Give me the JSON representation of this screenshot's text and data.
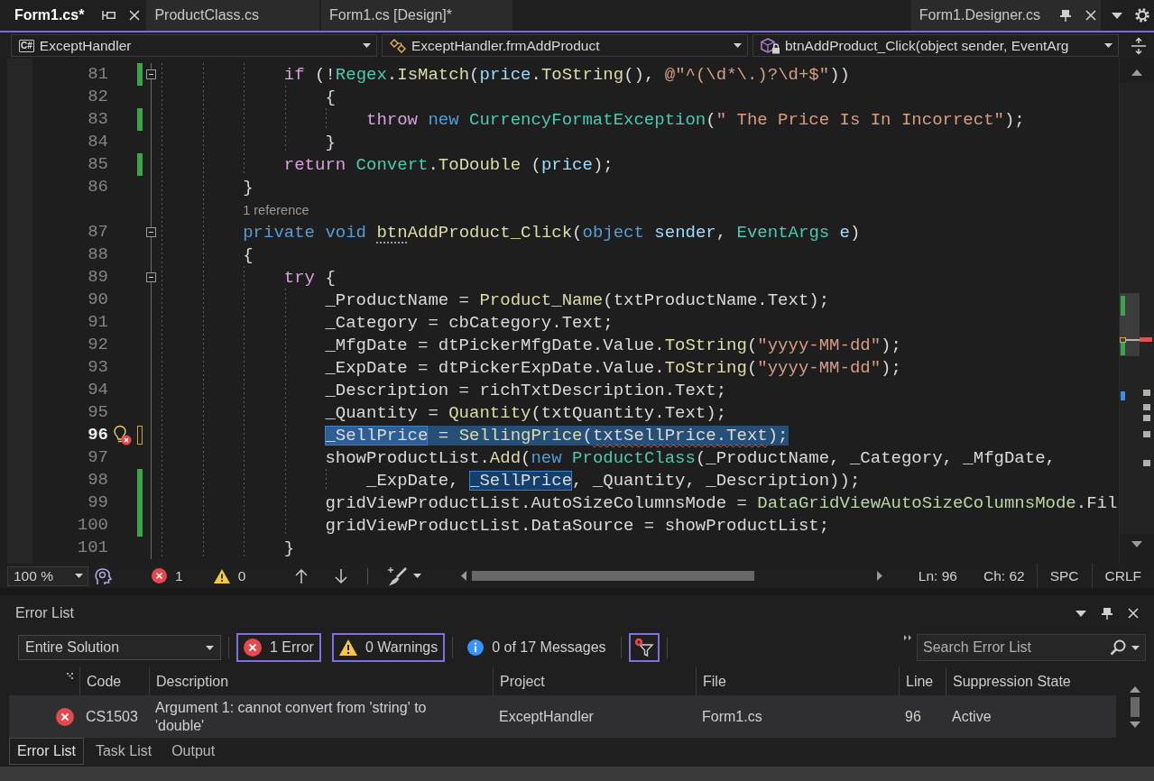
{
  "tabs": [
    {
      "label": "Form1.cs*",
      "selected": true,
      "pinned": false,
      "show_buttons": true
    },
    {
      "label": "ProductClass.cs",
      "selected": false,
      "pinned": false,
      "show_buttons": false
    },
    {
      "label": "Form1.cs [Design]*",
      "selected": false,
      "pinned": false,
      "show_buttons": false
    },
    {
      "label": "Form1.Designer.cs",
      "selected": false,
      "pinned": true,
      "show_buttons": true
    }
  ],
  "nav_bar": {
    "project_badge": "C#",
    "project": "ExceptHandler",
    "type": "ExceptHandler.frmAddProduct",
    "member": "btnAddProduct_Click(object sender, EventArg"
  },
  "editor": {
    "lines": [
      {
        "kind": "code",
        "number": "81",
        "current": false,
        "fold": true,
        "saved_change": true,
        "unsaved_change": false,
        "lightbulb": false,
        "selected": false,
        "code": [
          {
            "text": "            if",
            "kind": "control"
          },
          {
            "text": " (!",
            "kind": "plain"
          },
          {
            "text": "Regex",
            "kind": "type"
          },
          {
            "text": ".",
            "kind": "plain"
          },
          {
            "text": "IsMatch",
            "kind": "method"
          },
          {
            "text": "(",
            "kind": "plain"
          },
          {
            "text": "price",
            "kind": "param"
          },
          {
            "text": ".",
            "kind": "plain"
          },
          {
            "text": "ToString",
            "kind": "method"
          },
          {
            "text": "(), ",
            "kind": "plain"
          },
          {
            "text": "@\"^(\\d*\\.)?\\d+$\"",
            "kind": "string"
          },
          {
            "text": "))",
            "kind": "plain"
          }
        ]
      },
      {
        "kind": "code",
        "number": "82",
        "current": false,
        "fold": false,
        "saved_change": false,
        "unsaved_change": false,
        "lightbulb": false,
        "selected": false,
        "code": [
          {
            "text": "                {",
            "kind": "plain"
          }
        ]
      },
      {
        "kind": "code",
        "number": "83",
        "current": false,
        "fold": false,
        "saved_change": true,
        "unsaved_change": false,
        "lightbulb": false,
        "selected": false,
        "code": [
          {
            "text": "                    throw",
            "kind": "control"
          },
          {
            "text": " new",
            "kind": "keyword"
          },
          {
            "text": " CurrencyFormatException",
            "kind": "type"
          },
          {
            "text": "(",
            "kind": "plain"
          },
          {
            "text": "\" The Price Is In Incorrect\"",
            "kind": "string"
          },
          {
            "text": ");",
            "kind": "plain"
          }
        ]
      },
      {
        "kind": "code",
        "number": "84",
        "current": false,
        "fold": false,
        "saved_change": false,
        "unsaved_change": false,
        "lightbulb": false,
        "selected": false,
        "code": [
          {
            "text": "                }",
            "kind": "plain"
          }
        ]
      },
      {
        "kind": "code",
        "number": "85",
        "current": false,
        "fold": false,
        "saved_change": true,
        "unsaved_change": false,
        "lightbulb": false,
        "selected": false,
        "code": [
          {
            "text": "            return",
            "kind": "control"
          },
          {
            "text": " Convert",
            "kind": "type"
          },
          {
            "text": ".",
            "kind": "plain"
          },
          {
            "text": "ToDouble",
            "kind": "method"
          },
          {
            "text": " (",
            "kind": "plain"
          },
          {
            "text": "price",
            "kind": "param"
          },
          {
            "text": ");",
            "kind": "plain"
          }
        ]
      },
      {
        "kind": "code",
        "number": "86",
        "current": false,
        "fold": false,
        "saved_change": false,
        "unsaved_change": false,
        "lightbulb": false,
        "selected": false,
        "code": [
          {
            "text": "        }",
            "kind": "plain"
          }
        ]
      },
      {
        "kind": "codelens",
        "text": "1 reference"
      },
      {
        "kind": "code",
        "number": "87",
        "current": false,
        "fold": true,
        "saved_change": false,
        "unsaved_change": false,
        "lightbulb": false,
        "selected": false,
        "code": [
          {
            "text": "        private",
            "kind": "keyword"
          },
          {
            "text": " void ",
            "kind": "keyword"
          },
          {
            "text": "btn",
            "kind": "method",
            "hint": true
          },
          {
            "text": "AddProduct_Click",
            "kind": "method"
          },
          {
            "text": "(",
            "kind": "plain"
          },
          {
            "text": "object",
            "kind": "keyword"
          },
          {
            "text": " sender",
            "kind": "param"
          },
          {
            "text": ", ",
            "kind": "plain"
          },
          {
            "text": "EventArgs",
            "kind": "type"
          },
          {
            "text": " e",
            "kind": "param"
          },
          {
            "text": ")",
            "kind": "plain"
          }
        ]
      },
      {
        "kind": "code",
        "number": "88",
        "current": false,
        "fold": false,
        "saved_change": false,
        "unsaved_change": false,
        "lightbulb": false,
        "selected": false,
        "code": [
          {
            "text": "        {",
            "kind": "plain"
          }
        ]
      },
      {
        "kind": "code",
        "number": "89",
        "current": false,
        "fold": true,
        "saved_change": false,
        "unsaved_change": false,
        "lightbulb": false,
        "selected": false,
        "code": [
          {
            "text": "            try",
            "kind": "control"
          },
          {
            "text": " {",
            "kind": "plain"
          }
        ]
      },
      {
        "kind": "code",
        "number": "90",
        "current": false,
        "fold": false,
        "saved_change": false,
        "unsaved_change": false,
        "lightbulb": false,
        "selected": false,
        "code": [
          {
            "text": "                _ProductName = ",
            "kind": "plain"
          },
          {
            "text": "Product_Name",
            "kind": "method"
          },
          {
            "text": "(txtProductName.Text);",
            "kind": "plain"
          }
        ]
      },
      {
        "kind": "code",
        "number": "91",
        "current": false,
        "fold": false,
        "saved_change": false,
        "unsaved_change": false,
        "lightbulb": false,
        "selected": false,
        "code": [
          {
            "text": "                _Category = cbCategory.Text;",
            "kind": "plain"
          }
        ]
      },
      {
        "kind": "code",
        "number": "92",
        "current": false,
        "fold": false,
        "saved_change": false,
        "unsaved_change": false,
        "lightbulb": false,
        "selected": false,
        "code": [
          {
            "text": "                _MfgDate = dtPickerMfgDate.Value.",
            "kind": "plain"
          },
          {
            "text": "ToString",
            "kind": "method"
          },
          {
            "text": "(",
            "kind": "plain"
          },
          {
            "text": "\"yyyy-MM-dd\"",
            "kind": "string"
          },
          {
            "text": ");",
            "kind": "plain"
          }
        ]
      },
      {
        "kind": "code",
        "number": "93",
        "current": false,
        "fold": false,
        "saved_change": false,
        "unsaved_change": false,
        "lightbulb": false,
        "selected": false,
        "code": [
          {
            "text": "                _ExpDate = dtPickerExpDate.Value.",
            "kind": "plain"
          },
          {
            "text": "ToString",
            "kind": "method"
          },
          {
            "text": "(",
            "kind": "plain"
          },
          {
            "text": "\"yyyy-MM-dd\"",
            "kind": "string"
          },
          {
            "text": ");",
            "kind": "plain"
          }
        ]
      },
      {
        "kind": "code",
        "number": "94",
        "current": false,
        "fold": false,
        "saved_change": false,
        "unsaved_change": false,
        "lightbulb": false,
        "selected": false,
        "code": [
          {
            "text": "                _Description = richTxtDescription.Text;",
            "kind": "plain"
          }
        ]
      },
      {
        "kind": "code",
        "number": "95",
        "current": false,
        "fold": false,
        "saved_change": false,
        "unsaved_change": false,
        "lightbulb": false,
        "selected": false,
        "code": [
          {
            "text": "                _Quantity = ",
            "kind": "plain"
          },
          {
            "text": "Quantity",
            "kind": "method"
          },
          {
            "text": "(txtQuantity.Text);",
            "kind": "plain"
          }
        ]
      },
      {
        "kind": "code",
        "number": "96",
        "current": true,
        "fold": false,
        "saved_change": false,
        "unsaved_change": true,
        "lightbulb": true,
        "selected": true,
        "code": [
          {
            "text": "                _SellPrice",
            "kind": "plain",
            "highlighted": true
          },
          {
            "text": " = ",
            "kind": "plain"
          },
          {
            "text": "SellingPrice",
            "kind": "method"
          },
          {
            "text": "(",
            "kind": "plain"
          },
          {
            "text": "txtSellPrice.Text",
            "kind": "plain",
            "error": true
          },
          {
            "text": ");",
            "kind": "plain"
          }
        ]
      },
      {
        "kind": "code",
        "number": "97",
        "current": false,
        "fold": false,
        "saved_change": false,
        "unsaved_change": false,
        "lightbulb": false,
        "selected": false,
        "code": [
          {
            "text": "                showProductList.",
            "kind": "plain"
          },
          {
            "text": "Add",
            "kind": "method"
          },
          {
            "text": "(",
            "kind": "plain"
          },
          {
            "text": "new",
            "kind": "keyword"
          },
          {
            "text": " ProductClass",
            "kind": "type"
          },
          {
            "text": "(_ProductName, _Category, _MfgDate,",
            "kind": "plain"
          }
        ]
      },
      {
        "kind": "code",
        "number": "98",
        "current": false,
        "fold": false,
        "saved_change": true,
        "unsaved_change": false,
        "lightbulb": false,
        "selected": false,
        "code": [
          {
            "text": "                    _ExpDate, ",
            "kind": "plain"
          },
          {
            "text": "_SellPrice",
            "kind": "plain",
            "highlighted": true
          },
          {
            "text": ", _Quantity, _Description));",
            "kind": "plain"
          }
        ]
      },
      {
        "kind": "code",
        "number": "99",
        "current": false,
        "fold": false,
        "saved_change": true,
        "unsaved_change": false,
        "lightbulb": false,
        "selected": false,
        "code": [
          {
            "text": "                gridViewProductList.AutoSizeColumnsMode = ",
            "kind": "plain"
          },
          {
            "text": "DataGridViewAutoSizeColumnsMode",
            "kind": "enum"
          },
          {
            "text": ".Fil",
            "kind": "plain"
          }
        ]
      },
      {
        "kind": "code",
        "number": "100",
        "current": false,
        "fold": false,
        "saved_change": true,
        "unsaved_change": false,
        "lightbulb": false,
        "selected": false,
        "code": [
          {
            "text": "                gridViewProductList.DataSource = showProductList;",
            "kind": "plain"
          }
        ]
      },
      {
        "kind": "code",
        "number": "101",
        "current": false,
        "fold": false,
        "saved_change": false,
        "unsaved_change": false,
        "lightbulb": false,
        "selected": false,
        "code": [
          {
            "text": "            }",
            "kind": "plain"
          }
        ]
      }
    ]
  },
  "status_bar": {
    "zoom": "100 %",
    "errors": "1",
    "warnings": "0",
    "line": "Ln: 96",
    "column": "Ch: 62",
    "whitespace": "SPC",
    "line_ending": "CRLF"
  },
  "error_list": {
    "title": "Error List",
    "scope": "Entire Solution",
    "filters": [
      {
        "kind": "error",
        "label": "1 Error",
        "selected": true
      },
      {
        "kind": "warning",
        "label": "0 Warnings",
        "selected": true
      },
      {
        "kind": "info",
        "label": "0 of 17 Messages",
        "selected": false
      }
    ],
    "build_filter": {
      "selected": true
    },
    "search": {
      "placeholder": "Search Error List"
    },
    "columns": [
      "Code",
      "Description",
      "Project",
      "File",
      "Line",
      "Suppression State"
    ],
    "rows": [
      {
        "kind": "error",
        "selected": true,
        "code": "CS1503",
        "description": "Argument 1: cannot convert from 'string' to 'double'",
        "project": "ExceptHandler",
        "file": "Form1.cs",
        "line": "96",
        "suppression_state": "Active"
      }
    ]
  },
  "bottom_tabs": [
    {
      "label": "Error List",
      "selected": true
    },
    {
      "label": "Task List",
      "selected": false
    },
    {
      "label": "Output",
      "selected": false
    }
  ]
}
